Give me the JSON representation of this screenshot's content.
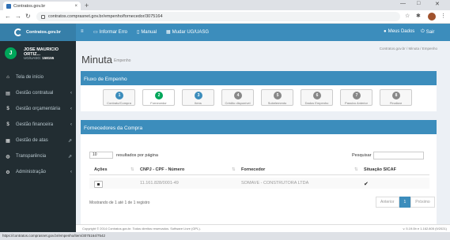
{
  "browser": {
    "tab_title": "Contratos.gov.br",
    "tab_close": "×",
    "new_tab": "+",
    "url": "contratos.comprasnet.gov.br/empenho/fornecedor/3075164",
    "win_min": "—",
    "win_max": "□",
    "win_close": "✕",
    "nav_back": "←",
    "nav_fwd": "→",
    "nav_reload": "↻",
    "star": "☆",
    "ext": "✱",
    "more": "⋮"
  },
  "header": {
    "logo_text": "Contratos.gov.br",
    "menu_icon": "≡",
    "informar_erro": "Informar Erro",
    "manual": "Manual",
    "mudar": "Mudar UG/UASG",
    "meus_dados": "Meus Dados",
    "sair": "Sair"
  },
  "user": {
    "initial": "J",
    "name": "JOSE MAURICIO ORTIZ...",
    "uasg_label": "UG/UASG:",
    "uasg_value": "158155"
  },
  "sidebar": {
    "items": [
      {
        "label": "Tela de início",
        "icon": "⌂",
        "suffix": ""
      },
      {
        "label": "Gestão contratual",
        "icon": "▤",
        "suffix": "‹"
      },
      {
        "label": "Gestão orçamentária",
        "icon": "$",
        "suffix": "‹"
      },
      {
        "label": "Gestão financeira",
        "icon": "$",
        "suffix": "‹"
      },
      {
        "label": "Gestão de atas",
        "icon": "▦",
        "suffix": "⇗"
      },
      {
        "label": "Transparência",
        "icon": "◍",
        "suffix": "⇗"
      },
      {
        "label": "Administração",
        "icon": "⚙",
        "suffix": "‹"
      }
    ]
  },
  "page": {
    "title": "Minuta",
    "subtitle": "Empenho",
    "breadcrumb": "Contratos.gov.br  /  Minuta  /  Empenho"
  },
  "fluxo": {
    "title": "Fluxo de Empenho",
    "steps": [
      {
        "num": "1",
        "label": "Contrato/Compra"
      },
      {
        "num": "2",
        "label": "Fornecedor"
      },
      {
        "num": "3",
        "label": "Itens"
      },
      {
        "num": "4",
        "label": "Crédito disponível"
      },
      {
        "num": "5",
        "label": "Subelemento"
      },
      {
        "num": "6",
        "label": "Dados Empenho"
      },
      {
        "num": "7",
        "label": "Passivo Anterior"
      },
      {
        "num": "8",
        "label": "Finalizar"
      }
    ]
  },
  "fornecedores": {
    "title": "Fornecedores da Compra",
    "page_len": "10",
    "page_len_label": "resultados por página",
    "search_label": "Pesquisar",
    "columns": {
      "acoes": "Ações",
      "cnpj": "CNPJ - CPF - Número",
      "fornecedor": "Fornecedor",
      "sicaf": "Situação SICAF"
    },
    "sort_icon": "⇅",
    "rows": [
      {
        "cnpj": "11.161.828/0001-49",
        "fornecedor": "SOMAVE - CONSTRUTORA LTDA",
        "sicaf": "✔"
      }
    ],
    "info": "Mostrando de 1 até 1 de 1 registro",
    "pager": {
      "prev": "Anterior",
      "current": "1",
      "next": "Próximo"
    }
  },
  "footer": {
    "text": "Copyright © 2014 Contratos.gov.br. Todos direitos reservados. Software Livre (GPL).",
    "version": "v. 5.19.0b e 1.162.805 (9/2021)"
  },
  "statusbar": {
    "text": "https://contratos.comprasnet.gov.br/empenho/item/3075164/7542"
  },
  "colors": {
    "accent": "#3c8dbc",
    "sidebar": "#222d32",
    "step_done": "#3c8dbc",
    "step_current": "#00a65a",
    "step_pending": "#888888"
  }
}
